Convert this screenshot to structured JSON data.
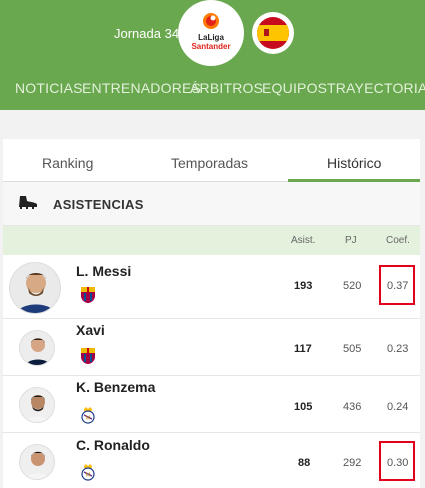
{
  "header": {
    "jornada": "Jornada 34",
    "league_logo": {
      "line1": "LaLiga",
      "line2": "Santander"
    },
    "nav": [
      "NOTICIAS",
      "ENTRENADORES",
      "ÁRBITROS",
      "EQUIPOS",
      "TRAYECTORIA"
    ]
  },
  "tabs": [
    "Ranking",
    "Temporadas",
    "Histórico"
  ],
  "active_tab": "Histórico",
  "section": {
    "title": "ASISTENCIAS",
    "icon": "boot-icon"
  },
  "columns": {
    "asist": "Asist.",
    "pj": "PJ",
    "coef": "Coef."
  },
  "players": [
    {
      "name": "L. Messi",
      "club": "fc-barcelona-crest",
      "asist": "193",
      "pj": "520",
      "coef": "0.37",
      "highlight": true
    },
    {
      "name": "Xavi",
      "club": "fc-barcelona-crest",
      "asist": "117",
      "pj": "505",
      "coef": "0.23",
      "highlight": false
    },
    {
      "name": "K. Benzema",
      "club": "real-madrid-crest",
      "asist": "105",
      "pj": "436",
      "coef": "0.24",
      "highlight": false
    },
    {
      "name": "C. Ronaldo",
      "club": "real-madrid-crest",
      "asist": "88",
      "pj": "292",
      "coef": "0.30",
      "highlight": true
    }
  ],
  "colors": {
    "brand_green": "#6aa84f",
    "highlight_red": "#e2001a",
    "table_header": "#e4f1dd"
  }
}
